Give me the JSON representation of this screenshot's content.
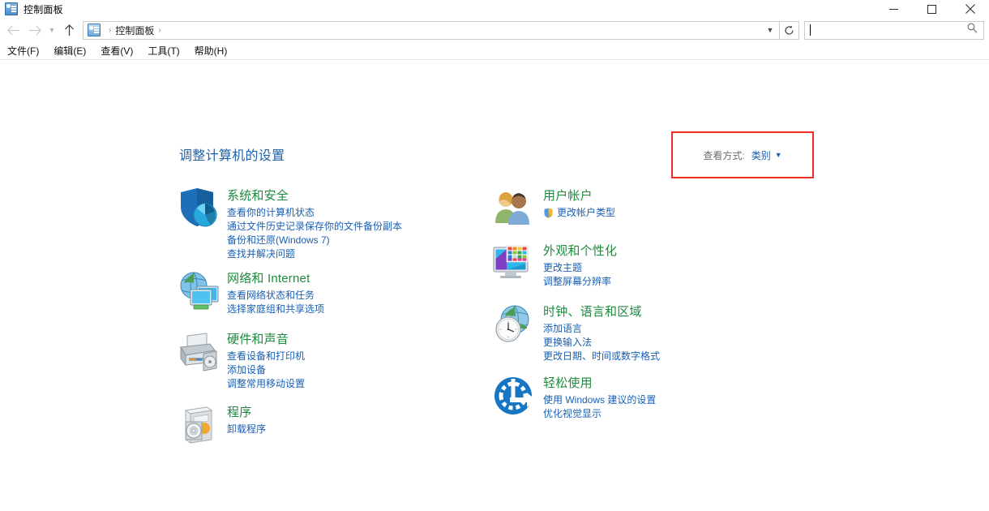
{
  "window": {
    "title": "控制面板",
    "icon": "control-panel-icon",
    "controls": {
      "minimize": "minimize-icon",
      "maximize": "maximize-icon",
      "close": "close-icon"
    }
  },
  "navbar": {
    "back": "back-arrow-icon",
    "forward": "forward-arrow-icon",
    "recent": "chevron-down-icon",
    "up": "up-arrow-icon",
    "breadcrumb": {
      "icon": "control-panel-icon",
      "sep1": "›",
      "item": "控制面板",
      "sep2": "›"
    },
    "address_dropdown": "chevron-down-icon",
    "refresh": "refresh-icon",
    "search": {
      "value": "",
      "placeholder": "",
      "icon": "search-icon"
    }
  },
  "menubar": {
    "items": [
      {
        "label": "文件(F)"
      },
      {
        "label": "编辑(E)"
      },
      {
        "label": "查看(V)"
      },
      {
        "label": "工具(T)"
      },
      {
        "label": "帮助(H)"
      }
    ]
  },
  "main": {
    "page_title": "调整计算机的设置",
    "view_by": {
      "label": "查看方式:",
      "value": "类别",
      "caret": "▼",
      "highlight_color": "#ee2d24"
    },
    "left_column": [
      {
        "icon": "shield-security-icon",
        "title": "系统和安全",
        "links": [
          {
            "text": "查看你的计算机状态",
            "shield": false
          },
          {
            "text": "通过文件历史记录保存你的文件备份副本",
            "shield": false
          },
          {
            "text": "备份和还原(Windows 7)",
            "shield": false
          },
          {
            "text": "查找并解决问题",
            "shield": false
          }
        ]
      },
      {
        "icon": "network-globe-monitor-icon",
        "title": "网络和 Internet",
        "links": [
          {
            "text": "查看网络状态和任务",
            "shield": false
          },
          {
            "text": "选择家庭组和共享选项",
            "shield": false
          }
        ]
      },
      {
        "icon": "printer-hardware-icon",
        "title": "硬件和声音",
        "links": [
          {
            "text": "查看设备和打印机",
            "shield": false
          },
          {
            "text": "添加设备",
            "shield": false
          },
          {
            "text": "调整常用移动设置",
            "shield": false
          }
        ]
      },
      {
        "icon": "programs-cd-box-icon",
        "title": "程序",
        "links": [
          {
            "text": "卸载程序",
            "shield": false
          }
        ]
      }
    ],
    "right_column": [
      {
        "icon": "user-accounts-people-icon",
        "title": "用户帐户",
        "links": [
          {
            "text": "更改帐户类型",
            "shield": true
          }
        ]
      },
      {
        "icon": "appearance-monitor-palette-icon",
        "title": "外观和个性化",
        "links": [
          {
            "text": "更改主题",
            "shield": false
          },
          {
            "text": "调整屏幕分辨率",
            "shield": false
          }
        ]
      },
      {
        "icon": "clock-globe-icon",
        "title": "时钟、语言和区域",
        "links": [
          {
            "text": "添加语言",
            "shield": false
          },
          {
            "text": "更换输入法",
            "shield": false
          },
          {
            "text": "更改日期、时间或数字格式",
            "shield": false
          }
        ]
      },
      {
        "icon": "ease-of-access-icon",
        "title": "轻松使用",
        "links": [
          {
            "text": "使用 Windows 建议的设置",
            "shield": false
          },
          {
            "text": "优化视觉显示",
            "shield": false
          }
        ]
      }
    ]
  },
  "colors": {
    "category_title": "#1f8a3e",
    "link": "#1a5fb4",
    "page_title": "#1f61a8",
    "highlight": "#ee2d24"
  }
}
